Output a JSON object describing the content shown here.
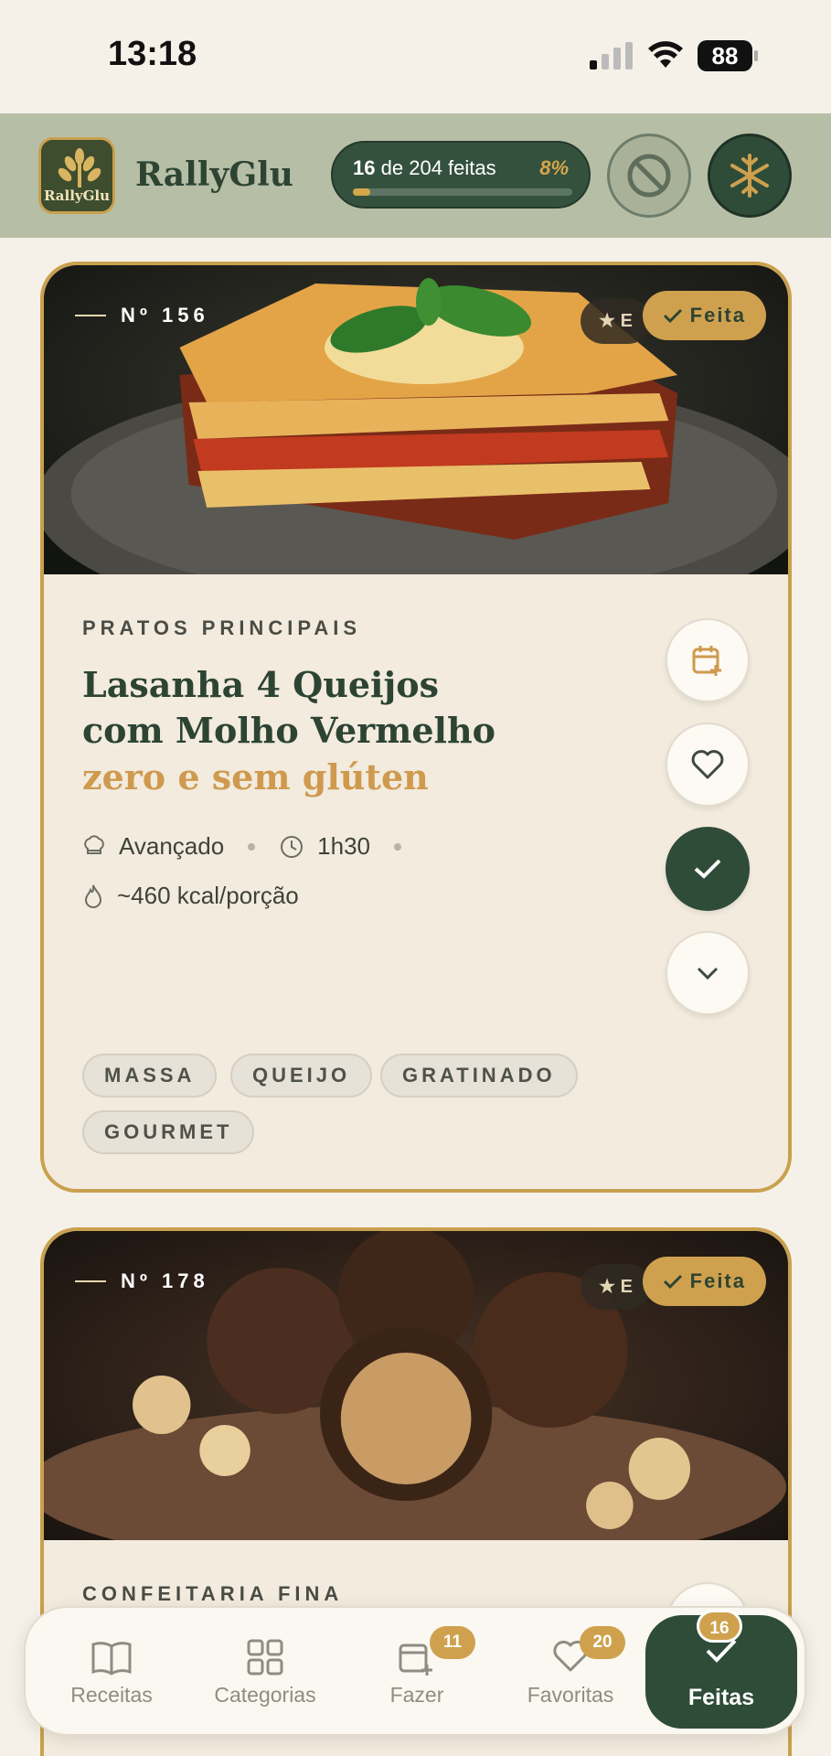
{
  "status_bar": {
    "time": "13:18",
    "battery": "88"
  },
  "header": {
    "app_name": "RallyGlu",
    "logo_text": "RallyGlu",
    "progress": {
      "done": "16",
      "mid": "de",
      "total": "204 feitas",
      "percent": "8%",
      "fraction": 0.08
    }
  },
  "recipes": [
    {
      "number": "Nº 156",
      "rating_chip": "E",
      "done_label": "Feita",
      "category": "PRATOS PRINCIPAIS",
      "title_line1": "Lasanha 4 Queijos",
      "title_line2": "com Molho Vermelho",
      "title_accent": "zero e sem glúten",
      "difficulty": "Avançado",
      "time": "1h30",
      "calories": "~460 kcal/porção",
      "tags": [
        "MASSA",
        "QUEIJO",
        "GRATINADO",
        "GOURMET"
      ]
    },
    {
      "number": "Nº 178",
      "rating_chip": "E",
      "done_label": "Feita",
      "category": "CONFEITARIA FINA"
    }
  ],
  "bottom_nav": [
    {
      "label": "Receitas",
      "icon": "book-icon"
    },
    {
      "label": "Categorias",
      "icon": "grid-icon"
    },
    {
      "label": "Fazer",
      "icon": "calendar-plus-icon",
      "badge": "11"
    },
    {
      "label": "Favoritas",
      "icon": "heart-icon",
      "badge": "20"
    },
    {
      "label": "Feitas",
      "icon": "check-icon",
      "badge": "16",
      "active": true
    }
  ],
  "colors": {
    "accent_gold": "#cfa14e",
    "dark_green": "#2f4c39",
    "header_bg": "#b7bea6",
    "card_bg": "#f2ebde"
  }
}
